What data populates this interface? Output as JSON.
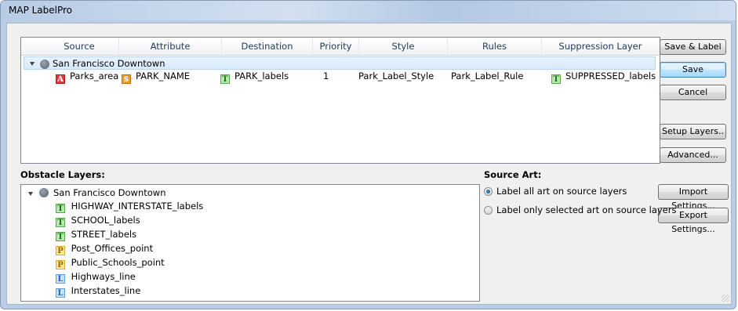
{
  "window": {
    "title": "MAP LabelPro"
  },
  "table": {
    "columns": [
      "Source",
      "Attribute",
      "Destination",
      "Priority",
      "Style",
      "Rules",
      "Suppression Layer"
    ],
    "group": {
      "name": "San Francisco Downtown"
    },
    "rows": [
      {
        "source_badge": "A",
        "source": "Parks_area",
        "attribute_badge": "S",
        "attribute": "PARK_NAME",
        "destination_badge": "T",
        "destination": "PARK_labels",
        "priority": "1",
        "style": "Park_Label_Style",
        "rules": "Park_Label_Rule",
        "suppression_badge": "T",
        "suppression": "SUPPRESSED_labels"
      }
    ]
  },
  "buttons": {
    "save_label": "Save & Label",
    "save": "Save",
    "cancel": "Cancel",
    "setup_layers": "Setup Layers..",
    "advanced": "Advanced...",
    "import_settings": "Import Settings...",
    "export_settings": "Export Settings..."
  },
  "obstacle": {
    "label": "Obstacle Layers:",
    "group": "San Francisco Downtown",
    "items": [
      {
        "badge": "T",
        "name": "HIGHWAY_INTERSTATE_labels"
      },
      {
        "badge": "T",
        "name": "SCHOOL_labels"
      },
      {
        "badge": "T",
        "name": "STREET_labels"
      },
      {
        "badge": "P",
        "name": "Post_Offices_point"
      },
      {
        "badge": "P",
        "name": "Public_Schools_point"
      },
      {
        "badge": "L",
        "name": "Highways_line"
      },
      {
        "badge": "L",
        "name": "Interstates_line"
      }
    ]
  },
  "source_art": {
    "label": "Source Art:",
    "options": [
      {
        "label": "Label all art on source layers",
        "selected": true
      },
      {
        "label": "Label only selected art on source layers",
        "selected": false
      }
    ]
  }
}
